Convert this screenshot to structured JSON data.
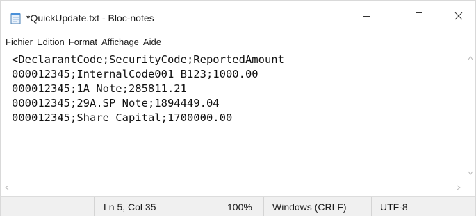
{
  "window": {
    "title": "*QuickUpdate.txt - Bloc-notes",
    "app_icon": "notepad-icon",
    "controls": {
      "minimize": "minimize-icon",
      "maximize": "maximize-icon",
      "close": "close-icon"
    }
  },
  "menu": {
    "items": [
      {
        "label": "Fichier"
      },
      {
        "label": "Edition"
      },
      {
        "label": "Format"
      },
      {
        "label": "Affichage"
      },
      {
        "label": "Aide"
      }
    ]
  },
  "editor": {
    "lines": [
      "<DeclarantCode;SecurityCode;ReportedAmount",
      "000012345;InternalCode001_B123;1000.00",
      "000012345;1A Note;285811.21",
      "000012345;29A.SP Note;1894449.04",
      "000012345;Share Capital;1700000.00"
    ]
  },
  "status": {
    "position": "Ln 5, Col 35",
    "zoom": "100%",
    "line_ending": "Windows (CRLF)",
    "encoding": "UTF-8"
  },
  "colors": {
    "status_bg": "#f0f0f0",
    "scroll_arrow": "#b5b5b5"
  }
}
